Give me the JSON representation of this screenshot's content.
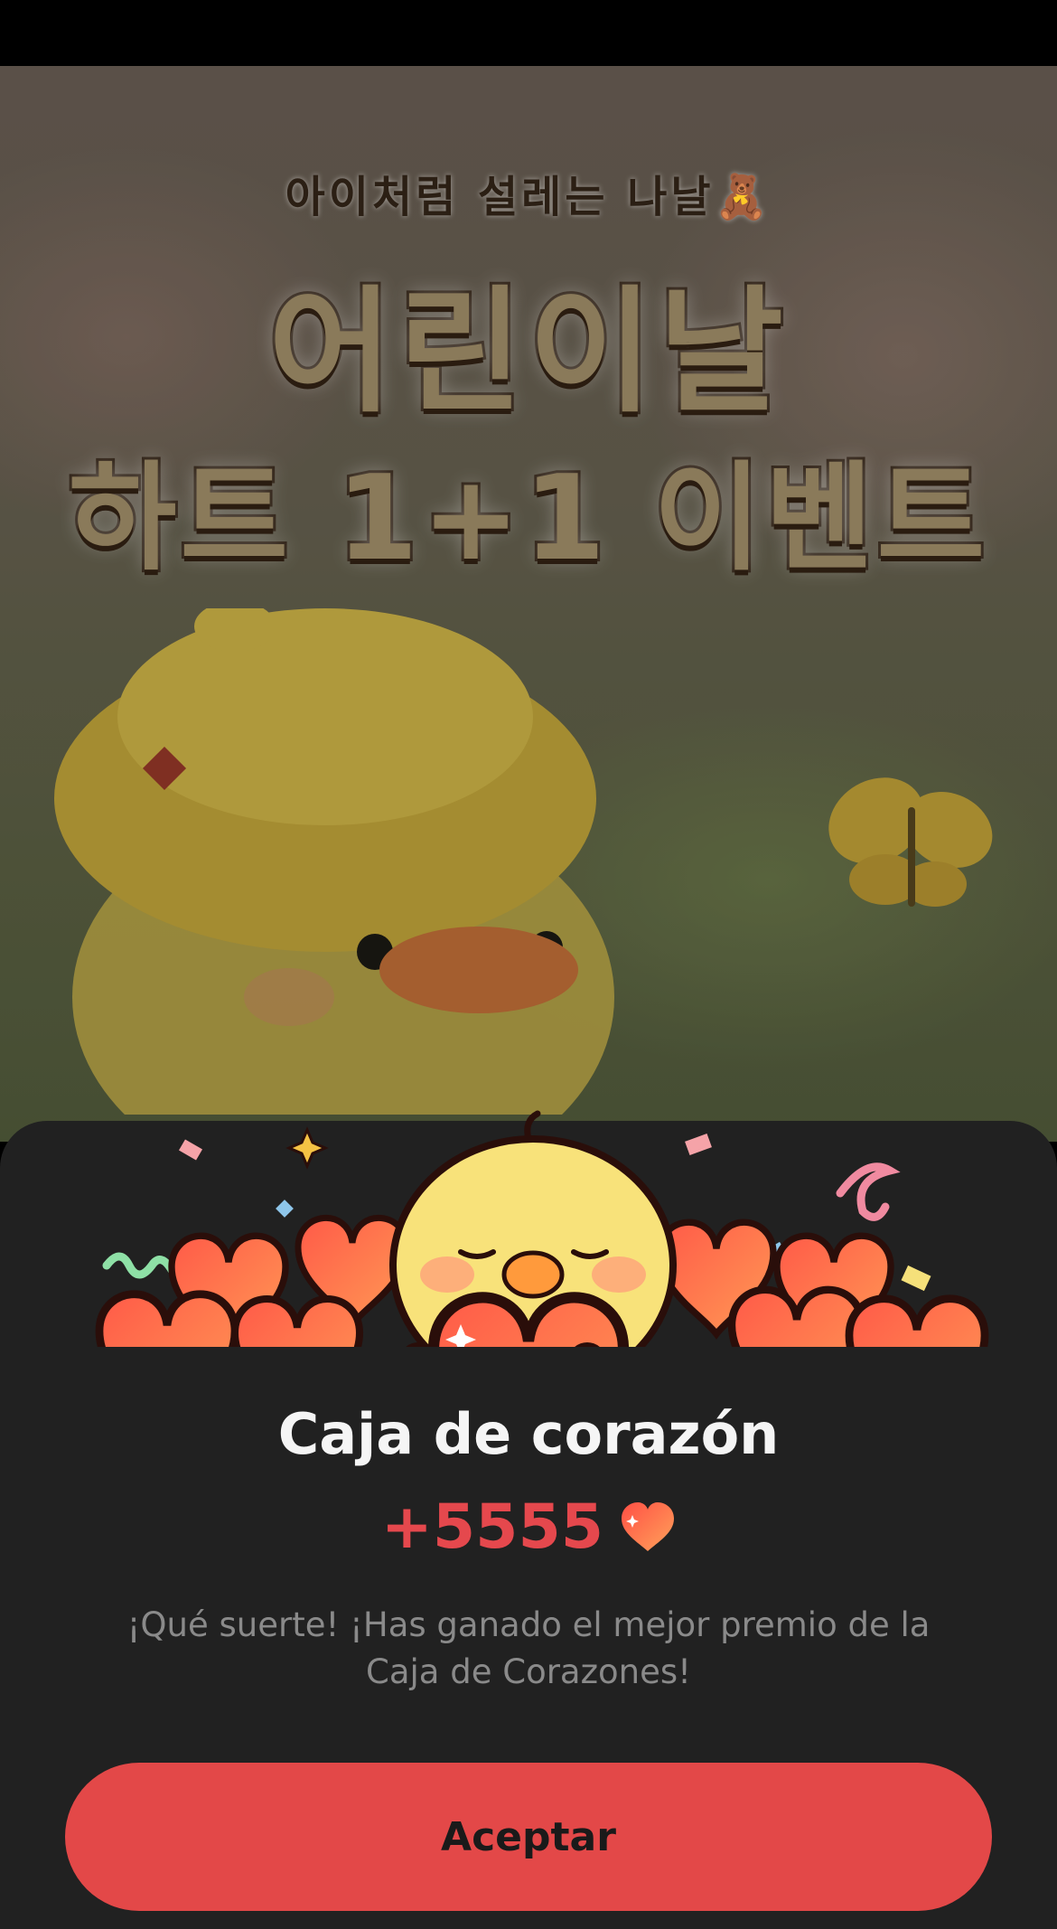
{
  "hero": {
    "subtitle": "아이처럼 설레는 나날🧸",
    "title_line1": "어린이날",
    "title_line2": "하트 1+1 이벤트"
  },
  "dialog": {
    "title": "Caja de corazón",
    "reward_amount": "+5555",
    "reward_icon": "heart-icon",
    "message": "¡Qué suerte! ¡Has ganado el mejor premio de la Caja de Corazones!",
    "accept_label": "Aceptar"
  },
  "colors": {
    "accent": "#e34848",
    "amount_text": "#e5484d",
    "sheet_background": "#212121",
    "heart": "#ff6a4d"
  }
}
